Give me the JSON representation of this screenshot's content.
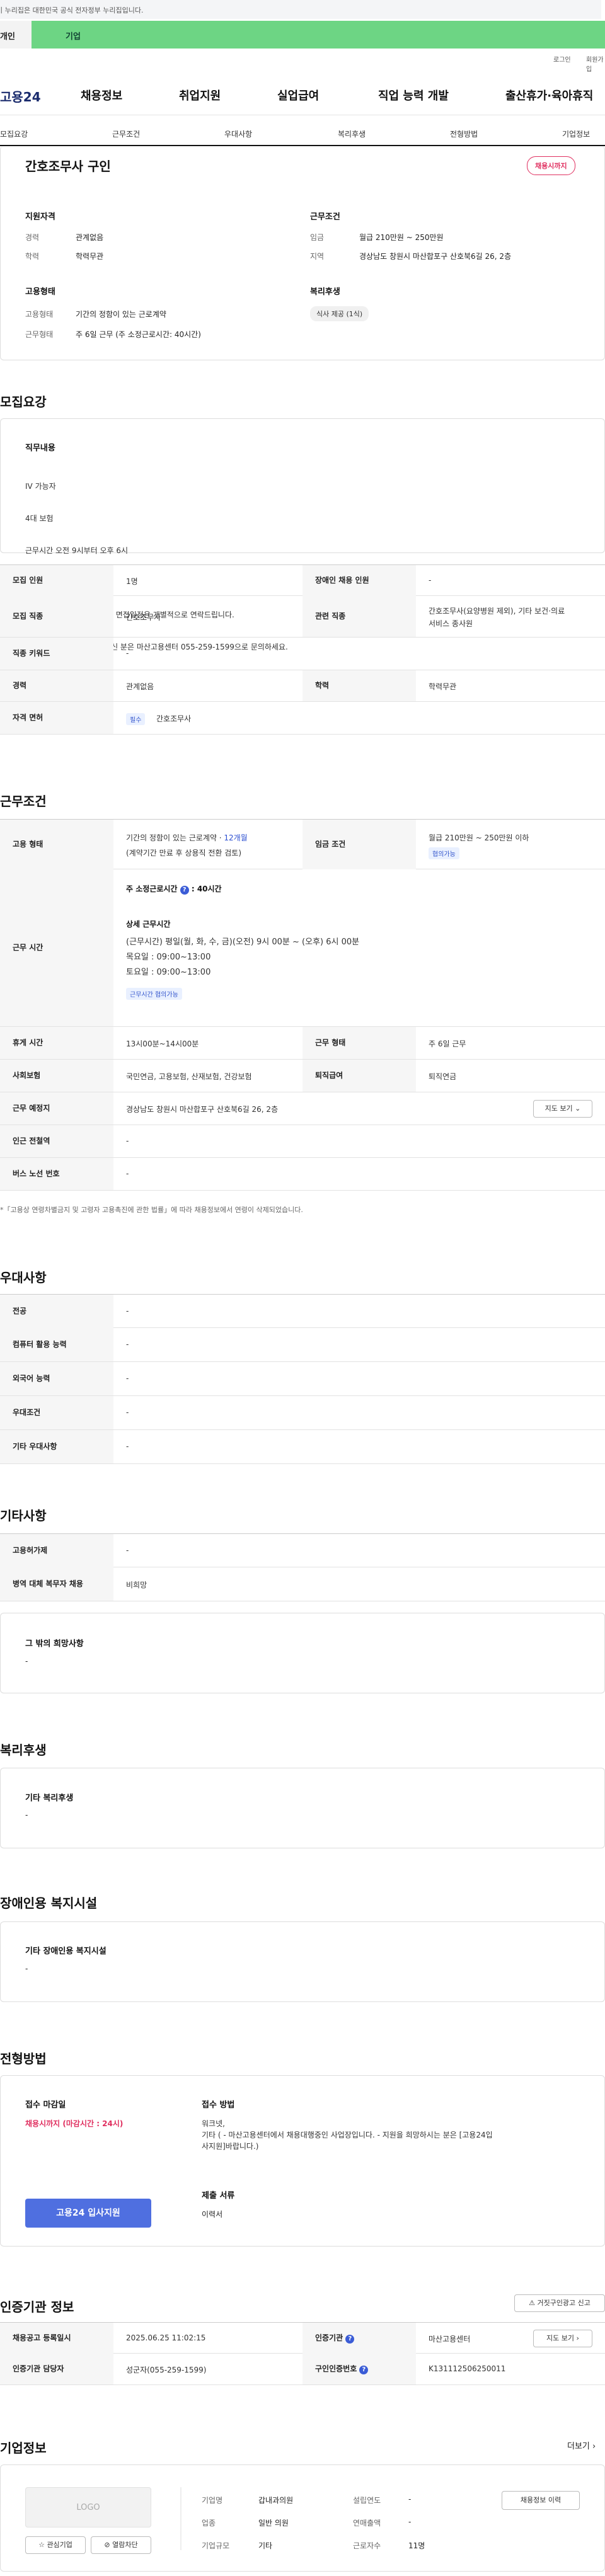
{
  "gov_banner": "이 누리집은 대한민국 공식 전자정부 누리집입니다.",
  "tabs": [
    "개인",
    "기업"
  ],
  "util": {
    "login": "로그인",
    "join": "회원가입"
  },
  "logo": "고용24",
  "gnb": [
    "채용정보",
    "취업지원",
    "실업급여",
    "직업 능력 개발",
    "출산휴가·육아휴직"
  ],
  "snb": [
    "모집요강",
    "근무조건",
    "우대사항",
    "복리후생",
    "전형방법",
    "기업정보"
  ],
  "summary": {
    "title": "간호조무사 구인",
    "status": "채용시까지",
    "qual_title": "지원자격",
    "cond_title": "근무조건",
    "emp_title": "고용형태",
    "welfare_title": "복리후생",
    "career_l": "경력",
    "career_v": "관계없음",
    "edu_l": "학력",
    "edu_v": "학력무관",
    "wage_l": "임금",
    "wage_v": "월급 210만원 ~ 250만원",
    "region_l": "지역",
    "region_v": "경상남도 창원시 마산합포구 산호북6길 26, 2층",
    "emptype_l": "고용형태",
    "emptype_v": "기간의 정함이 있는 근로계약",
    "worktype_l": "근무형태",
    "worktype_v": "주 6일 근무 (주 소정근로시간: 40시간)",
    "welfare_v": "식사 제공 (1식)"
  },
  "recruit": {
    "title": "모집요강",
    "duty_title": "직무내용",
    "duty_lines": [
      "IV 가능자",
      "4대 보험",
      "근무시간 오전 9시부터 오후 6시",
      "",
      "'고용24 입사지원' 해주시면 면접일정은 개별적으로 연락드립니다.",
      "'고용24입사지원'이 어려우신 분은 마산고용센터 055-259-1599으로 문의하세요."
    ],
    "rows": {
      "count_l": "모집 인원",
      "count_v": "1명",
      "disab_l": "장애인 채용 인원",
      "disab_v": "-",
      "job_l": "모집 직종",
      "job_v": "간호조무사",
      "rel_l": "관련 직종",
      "rel_v1": "간호조무사(요양병원 제외), 기타 보건·의료",
      "rel_v2": "서비스 종사원",
      "kw_l": "직종 키워드",
      "kw_v": "-",
      "career_l": "경력",
      "career_v": "관계없음",
      "edu_l": "학력",
      "edu_v": "학력무관",
      "lic_l": "자격 면허",
      "lic_tag": "필수",
      "lic_v": "간호조무사"
    }
  },
  "cond": {
    "title": "근무조건",
    "emp_l": "고용 형태",
    "emp_v1": "기간의 정함이 있는 근로계약 · ",
    "emp_v1b": "12개월",
    "emp_v2": "(계약기간 만료 후 상용직 전환 검토)",
    "wage_l": "임금 조건",
    "wage_v": "월급 210만원 ~ 250만원 이하",
    "wage_tag": "협의가능",
    "time_l": "근무 시간",
    "week_h": "주 소정근로시간",
    "week_v": ": 40시간",
    "detail_t": "상세 근무시간",
    "detail_lines": [
      "(근무시간) 평일(월, 화, 수, 금)(오전) 9시 00분 ~ (오후) 6시 00분",
      "목요일 : 09:00~13:00",
      "토요일 : 09:00~13:00"
    ],
    "time_tag": "근무시간 협의가능",
    "rest_l": "휴게 시간",
    "rest_v": "13시00분~14시00분",
    "form_l": "근무 형태",
    "form_v": "주 6일 근무",
    "ins_l": "사회보험",
    "ins_v": "국민연금, 고용보험, 산재보험, 건강보험",
    "ret_l": "퇴직급여",
    "ret_v": "퇴직연금",
    "place_l": "근무 예정지",
    "place_v": "경상남도 창원시 마산합포구 산호북6길 26, 2층",
    "map_btn": "지도 보기",
    "sub_l": "인근 전철역",
    "sub_v": "-",
    "bus_l": "버스 노선 번호",
    "bus_v": "-",
    "note": "*「고용상 연령차별금지 및 고령자 고용촉진에 관한 법률」에 따라 채용정보에서 연령이 삭제되었습니다."
  },
  "pref": {
    "title": "우대사항",
    "rows": [
      [
        "전공",
        "-"
      ],
      [
        "컴퓨터 활용 능력",
        "-"
      ],
      [
        "외국어 능력",
        "-"
      ],
      [
        "우대조건",
        "-"
      ],
      [
        "기타 우대사항",
        "-"
      ]
    ]
  },
  "etc": {
    "title": "기타사항",
    "rows": [
      [
        "고용허가제",
        "-"
      ],
      [
        "병역 대체 복무자 채용",
        "비희망"
      ]
    ],
    "box_t": "그 밖의 희망사항",
    "box_v": "-"
  },
  "welfare": {
    "title": "복리후생",
    "box_t": "기타 복리후생",
    "box_v": "-"
  },
  "disab": {
    "title": "장애인용 복지시설",
    "box_t": "기타 장애인용 복지시설",
    "box_v": "-"
  },
  "process": {
    "title": "전형방법",
    "deadline_t": "접수 마감일",
    "deadline_v": "채용시까지 (마감시간 : 24시)",
    "apply_btn": "고용24 입사지원",
    "method_t": "접수 방법",
    "method_lines": [
      "워크넷,",
      "기타 ( - 마산고용센터에서 채용대행중인 사업장입니다. - 지원을 희망하시는 분은 [고용24입",
      "사지원]바랍니다.)"
    ],
    "docs_t": "제출 서류",
    "docs_v": "이력서"
  },
  "cert": {
    "title": "인증기관 정보",
    "report_btn": "거짓구인광고 신고",
    "reg_l": "채용공고 등록일시",
    "reg_v": "2025.06.25 11:02:15",
    "org_l": "인증기관",
    "org_v": "마산고용센터",
    "map_btn": "지도 보기",
    "mgr_l": "인증기관 담당자",
    "mgr_v": "성군자(055-259-1599)",
    "no_l": "구인인증번호",
    "no_v": "K131112506250011"
  },
  "company": {
    "title": "기업정보",
    "more": "더보기",
    "logo": "LOGO",
    "fav_btn": "관심기업",
    "block_btn": "열람차단",
    "jobs_btn": "채용정보 이력",
    "info": [
      [
        "기업명",
        "갑내과의원",
        "설립연도",
        "-"
      ],
      [
        "업종",
        "일반 의원",
        "연매출액",
        "-"
      ],
      [
        "기업규모",
        "기타",
        "근로자수",
        "11명"
      ]
    ]
  }
}
